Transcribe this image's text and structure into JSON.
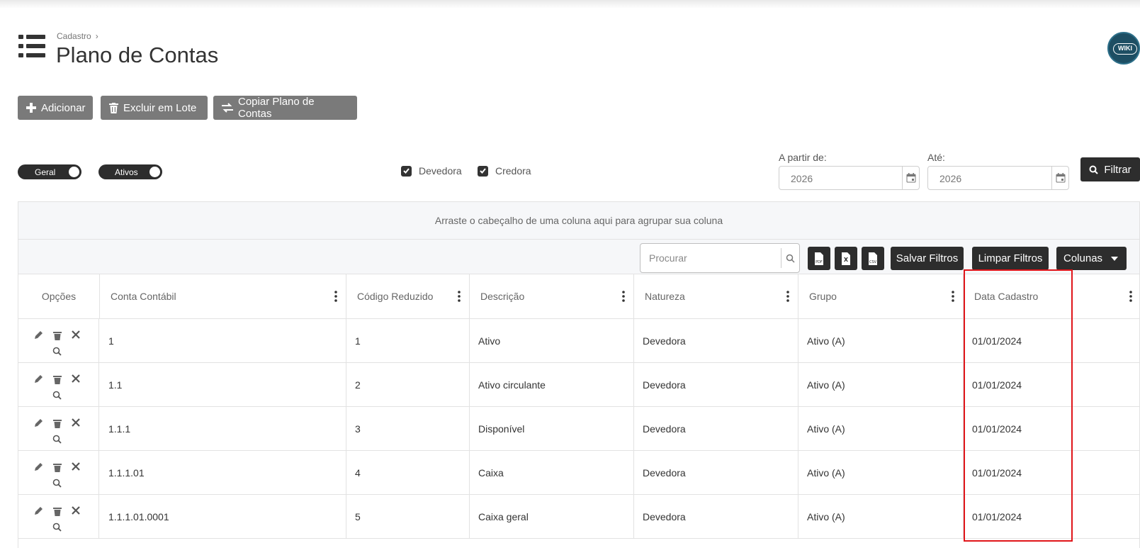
{
  "header": {
    "breadcrumb": "Cadastro",
    "breadcrumb_sep": "›",
    "title": "Plano de Contas",
    "wiki_label": "WIKI"
  },
  "actions": {
    "add": "Adicionar",
    "bulk_delete": "Excluir em Lote",
    "copy_plan": "Copiar Plano de Contas"
  },
  "filters": {
    "toggle_geral": "Geral",
    "toggle_ativos": "Ativos",
    "check_devedora": "Devedora",
    "check_credora": "Credora",
    "from_label": "A partir de:",
    "from_value": "2026",
    "to_label": "Até:",
    "to_value": "2026",
    "filter_button": "Filtrar"
  },
  "grid": {
    "group_panel_text": "Arraste o cabeçalho de uma coluna aqui para agrupar sua coluna",
    "search_placeholder": "Procurar",
    "save_filters": "Salvar Filtros",
    "clear_filters": "Limpar Filtros",
    "columns_button": "Colunas",
    "export_icons": [
      "pdf-export-icon",
      "excel-export-icon",
      "csv-export-icon"
    ],
    "headers": {
      "options": "Opções",
      "account": "Conta Contábil",
      "code": "Código Reduzido",
      "description": "Descrição",
      "nature": "Natureza",
      "group": "Grupo",
      "date": "Data Cadastro"
    },
    "rows": [
      {
        "account": "1",
        "code": "1",
        "description": "Ativo",
        "nature": "Devedora",
        "group": "Ativo (A)",
        "date": "01/01/2024"
      },
      {
        "account": "1.1",
        "code": "2",
        "description": "Ativo circulante",
        "nature": "Devedora",
        "group": "Ativo (A)",
        "date": "01/01/2024"
      },
      {
        "account": "1.1.1",
        "code": "3",
        "description": "Disponível",
        "nature": "Devedora",
        "group": "Ativo (A)",
        "date": "01/01/2024"
      },
      {
        "account": "1.1.1.01",
        "code": "4",
        "description": "Caixa",
        "nature": "Devedora",
        "group": "Ativo (A)",
        "date": "01/01/2024"
      },
      {
        "account": "1.1.1.01.0001",
        "code": "5",
        "description": "Caixa geral",
        "nature": "Devedora",
        "group": "Ativo (A)",
        "date": "01/01/2024"
      }
    ]
  },
  "colors": {
    "dark_button": "#2d2d2d",
    "gray_button": "#7a7a7a",
    "highlight": "#e0151a",
    "wiki_badge": "#1d4e63"
  }
}
